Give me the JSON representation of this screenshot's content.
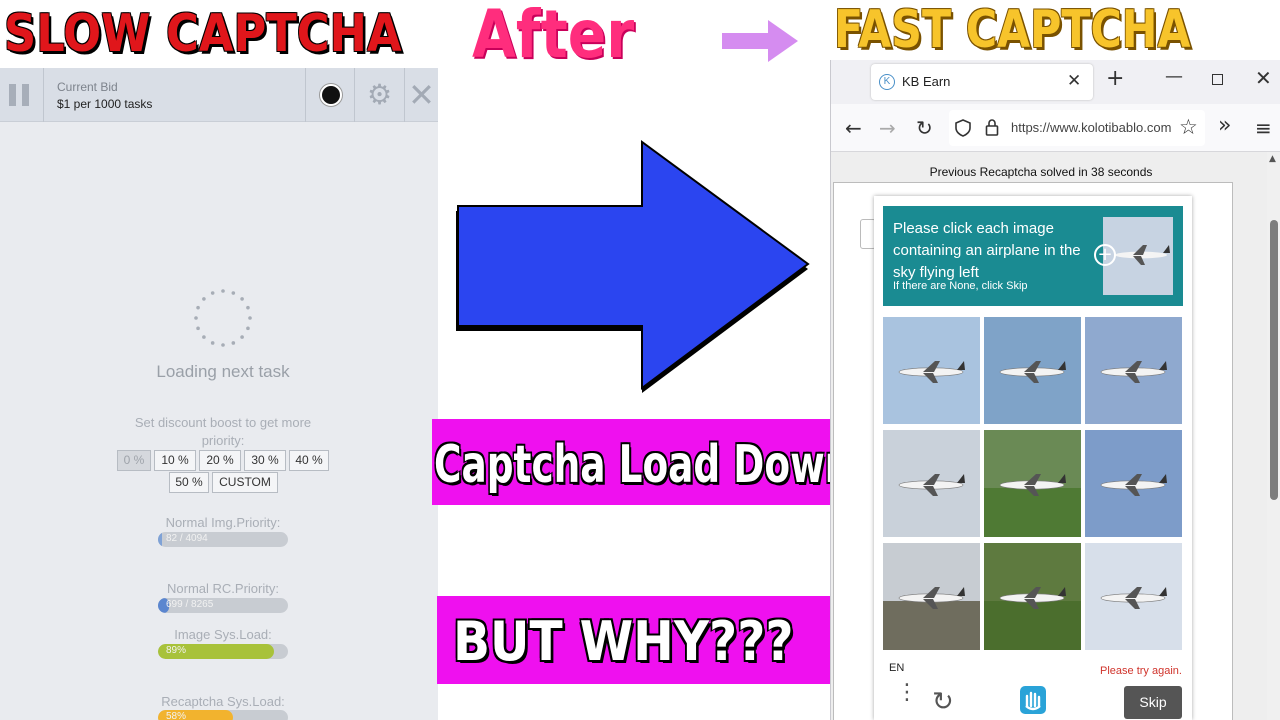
{
  "headings": {
    "slow": "SLOW CAPTCHA",
    "after": "After",
    "fast": "FAST CAPTCHA",
    "load_down": "Captcha Load Down",
    "but_why": "BUT WHY???"
  },
  "colors": {
    "slow_title": "#e0161b",
    "after_title": "#ff2d7d",
    "fast_title": "#f7c42b",
    "arrow": "#2b45f0",
    "small_arrow": "#d58cf0",
    "banner": "#ef10ef",
    "captcha_header": "#1a8b92"
  },
  "left_app": {
    "bid_label": "Current Bid",
    "bid_value": "$1 per 1000 tasks",
    "icons": [
      "pause-icon",
      "record-icon",
      "gear-icon",
      "close-icon"
    ],
    "loading_text": "Loading next task",
    "discount_text": "Set discount boost to get more priority:",
    "discount_options": [
      "0 %",
      "10 %",
      "20 %",
      "30 %",
      "40 %",
      "50 %",
      "CUSTOM"
    ],
    "meters": [
      {
        "label": "Normal Img.Priority:",
        "text": "82 / 4094",
        "fraction": 0.02,
        "color": "#7fa2d6"
      },
      {
        "label": "Normal RC.Priority:",
        "text": "699 / 8265",
        "fraction": 0.085,
        "color": "#5b86cf"
      },
      {
        "label": "Image Sys.Load:",
        "text": "89%",
        "fraction": 0.89,
        "color": "#a8c23a"
      },
      {
        "label": "Recaptcha Sys.Load:",
        "text": "58%",
        "fraction": 0.58,
        "color": "#f2b32e"
      }
    ]
  },
  "browser": {
    "tab_title": "KB Earn",
    "tab_favicon": "K",
    "url": "https://www.kolotibablo.com",
    "solved_text": "Previous Recaptcha solved in 38 seconds"
  },
  "captcha": {
    "title": "Please click each image containing an airplane in the sky flying left",
    "subtitle": "If there are None, click Skip",
    "lang": "EN",
    "error": "Please try again.",
    "skip_label": "Skip",
    "tiles": [
      "airplane-sky-tile",
      "airplane-sky-tile",
      "airplane-sky-tile",
      "airplane-sky-tile",
      "airplane-ground-tile",
      "airplane-sky-tile",
      "airplane-runway-tile",
      "airplane-ground-tile",
      "airplane-sky-tile"
    ]
  }
}
